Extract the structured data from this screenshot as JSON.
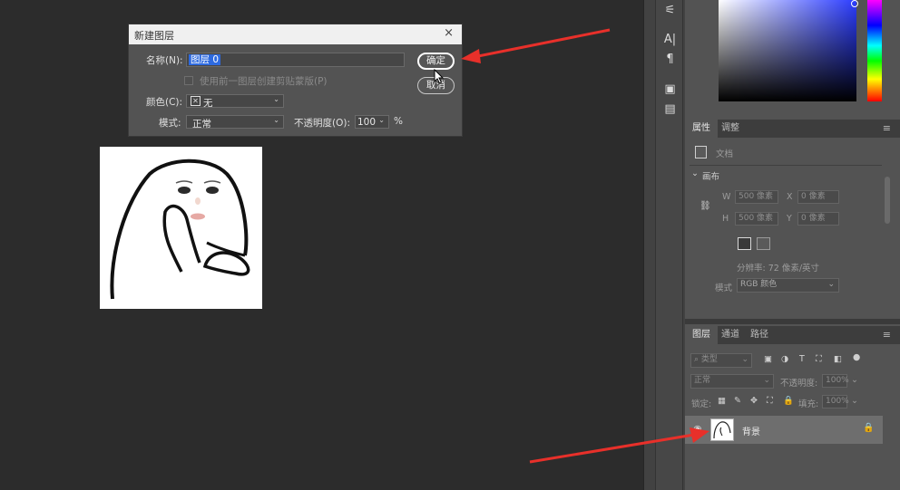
{
  "dialog": {
    "title": "新建图层",
    "close": "×",
    "name_label": "名称(N):",
    "name_value": "图层 0",
    "clip_label": "使用前一图层创建剪贴蒙版(P)",
    "color_label": "颜色(C):",
    "color_value": "无",
    "mode_label": "模式:",
    "mode_value": "正常",
    "opacity_label": "不透明度(O):",
    "opacity_value": "100",
    "percent": "%",
    "ok": "确定",
    "cancel": "取消"
  },
  "toolstrip": {
    "icons": [
      "sliders-icon",
      "character-icon",
      "paragraph-icon",
      "image-icon",
      "note-icon"
    ],
    "glyphs": [
      "⚟",
      "A|",
      "¶",
      "▣",
      "▤"
    ]
  },
  "properties": {
    "tab_properties": "属性",
    "tab_adjust": "调整",
    "doc_label": "文档",
    "section_canvas": "画布",
    "w_label": "W",
    "w_value": "500 像素",
    "x_label": "X",
    "x_value": "0 像素",
    "h_label": "H",
    "h_value": "500 像素",
    "y_label": "Y",
    "y_value": "0 像素",
    "resolution": "分辨率: 72 像素/英寸",
    "mode_label": "模式",
    "mode_value": "RGB 颜色"
  },
  "layers": {
    "tab_layers": "图层",
    "tab_channels": "通道",
    "tab_paths": "路径",
    "filter_placeholder": "类型",
    "blend_value": "正常",
    "opacity_label": "不透明度:",
    "opacity_value": "100%",
    "lock_label": "锁定:",
    "fill_label": "填充:",
    "fill_value": "100%",
    "layer_name": "背景"
  },
  "colors": {
    "accent_red": "#e8302a",
    "selection_blue": "#2d6ae0"
  }
}
